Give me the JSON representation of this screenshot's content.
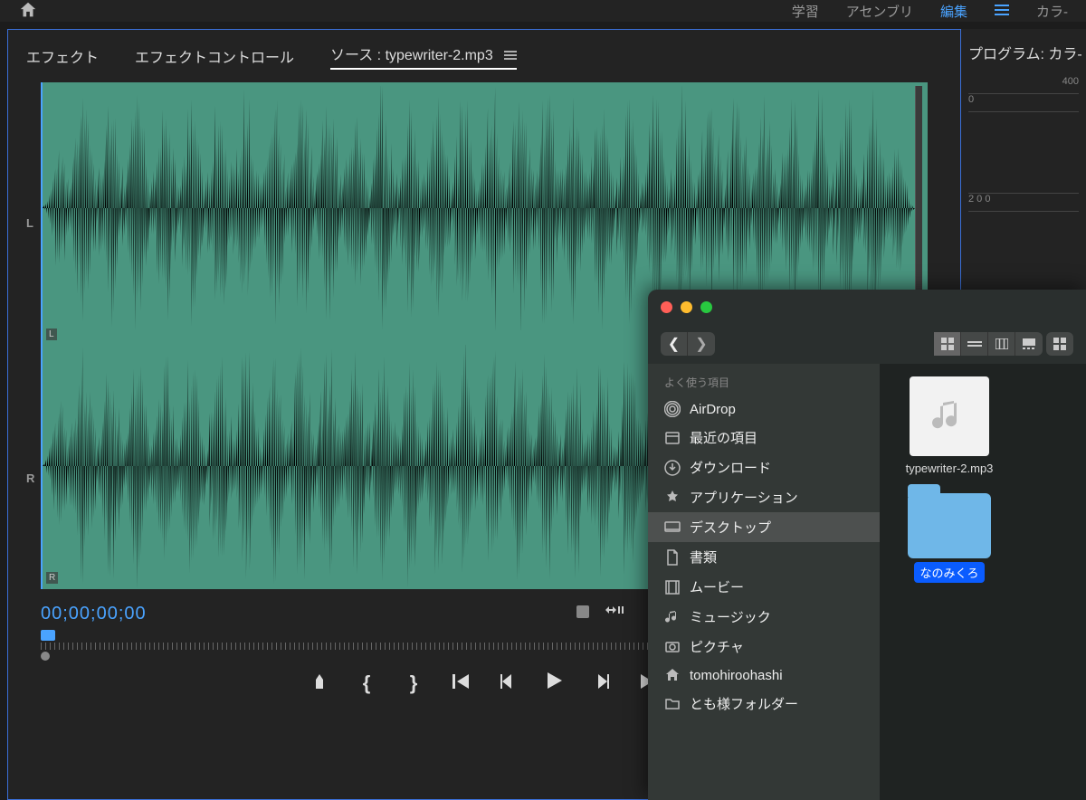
{
  "topbar": {
    "workspaces": [
      "学習",
      "アセンブリ",
      "編集",
      "カラ-"
    ],
    "active_workspace": "編集"
  },
  "source_panel": {
    "tabs": [
      "エフェクト",
      "エフェクトコントロール",
      "ソース : typewriter-2.mp3"
    ],
    "active_tab_index": 2,
    "channels": {
      "left": "L",
      "right": "R"
    },
    "channel_markers": {
      "m1": "L",
      "m2": "R"
    },
    "timecode": "00;00;00;00",
    "transport": {
      "marker": "marker",
      "in": "{",
      "out": "}",
      "goto_in": "go-to-in",
      "step_back": "step-back",
      "play": "play",
      "step_fwd": "step-fwd",
      "goto_out": "go-to-out"
    }
  },
  "program_panel": {
    "title": "プログラム: カラ-",
    "ruler_values": [
      "400",
      "0",
      "",
      "2 0 0"
    ]
  },
  "finder": {
    "sidebar_header": "よく使う項目",
    "sidebar": [
      {
        "icon": "airdrop-icon",
        "label": "AirDrop"
      },
      {
        "icon": "recents-icon",
        "label": "最近の項目"
      },
      {
        "icon": "downloads-icon",
        "label": "ダウンロード"
      },
      {
        "icon": "applications-icon",
        "label": "アプリケーション"
      },
      {
        "icon": "desktop-icon",
        "label": "デスクトップ",
        "selected": true
      },
      {
        "icon": "documents-icon",
        "label": "書類"
      },
      {
        "icon": "movies-icon",
        "label": "ムービー"
      },
      {
        "icon": "music-icon",
        "label": "ミュージック"
      },
      {
        "icon": "pictures-icon",
        "label": "ピクチャ"
      },
      {
        "icon": "home-icon",
        "label": "tomohiroohashi"
      },
      {
        "icon": "folder-icon",
        "label": "とも様フォルダー"
      }
    ],
    "files": [
      {
        "name": "typewriter-2.mp3",
        "type": "audio"
      },
      {
        "name": "なのみくろ",
        "type": "folder",
        "selected": true
      }
    ]
  }
}
